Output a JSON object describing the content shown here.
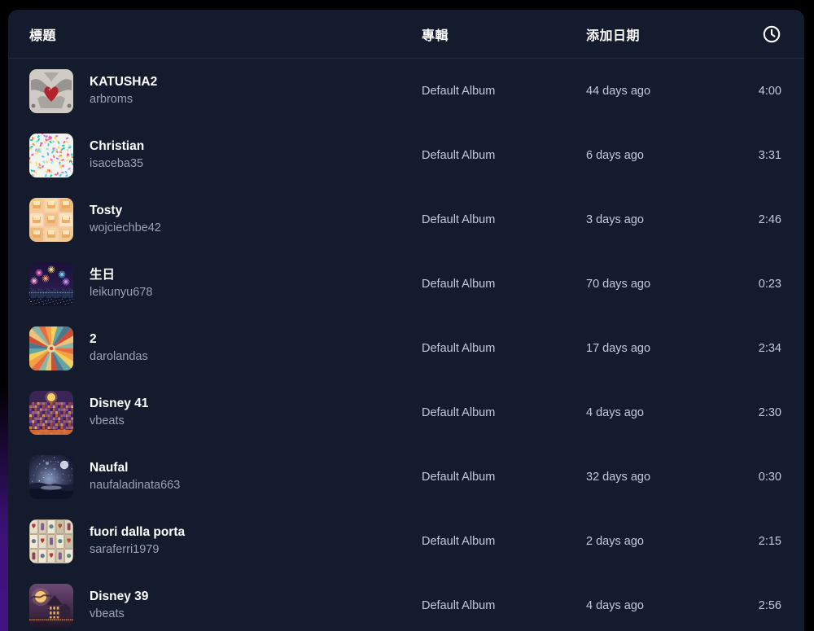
{
  "window": {
    "background_color": "#000000",
    "panel_color": "#141b2d"
  },
  "header": {
    "title_column": "標題",
    "album_column": "專輯",
    "date_added_column": "添加日期",
    "duration_column_icon": "clock-icon"
  },
  "colors": {
    "panel": "#141b2d",
    "title_text": "#ffffff",
    "secondary_text": "#9aa3b5",
    "meta_text": "#c3cad8",
    "divider": "#252c40",
    "glow": "#3e127c"
  },
  "tracks": [
    {
      "title": "KATUSHA2",
      "artist": "arbroms",
      "album": "Default Album",
      "date_added": "44 days ago",
      "duration": "4:00",
      "artwork": "winged-heart-artwork"
    },
    {
      "title": "Christian",
      "artist": "isaceba35",
      "album": "Default Album",
      "date_added": "6 days ago",
      "duration": "3:31",
      "artwork": "confetti-artwork"
    },
    {
      "title": "Tosty",
      "artist": "wojciechbe42",
      "album": "Default Album",
      "date_added": "3 days ago",
      "duration": "2:46",
      "artwork": "toast-grid-artwork"
    },
    {
      "title": "生日",
      "artist": "leikunyu678",
      "album": "Default Album",
      "date_added": "70 days ago",
      "duration": "0:23",
      "artwork": "fireworks-artwork"
    },
    {
      "title": "2",
      "artist": "darolandas",
      "album": "Default Album",
      "date_added": "17 days ago",
      "duration": "2:34",
      "artwork": "radial-burst-artwork"
    },
    {
      "title": "Disney 41",
      "artist": "vbeats",
      "album": "Default Album",
      "date_added": "4 days ago",
      "duration": "2:30",
      "artwork": "pixel-castle-artwork"
    },
    {
      "title": "Naufal",
      "artist": "naufaladinata663",
      "album": "Default Album",
      "date_added": "32 days ago",
      "duration": "0:30",
      "artwork": "galaxy-night-artwork"
    },
    {
      "title": "fuori dalla porta",
      "artist": "saraferri1979",
      "album": "Default Album",
      "date_added": "2 days ago",
      "duration": "2:15",
      "artwork": "tarot-cards-artwork"
    },
    {
      "title": "Disney 39",
      "artist": "vbeats",
      "album": "Default Album",
      "date_added": "4 days ago",
      "duration": "2:56",
      "artwork": "haunted-mansion-artwork"
    }
  ]
}
